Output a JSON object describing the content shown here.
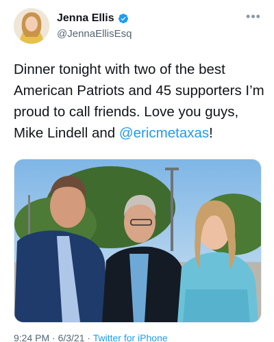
{
  "author": {
    "display_name": "Jenna Ellis",
    "handle": "@JennaEllisEsq",
    "verified": true
  },
  "more_icon": "more-horizontal-icon",
  "tweet": {
    "text_before_mention": "Dinner tonight with two of the best American Patriots and 45 supporters I’m proud to call friends. Love you guys, Mike Lindell and ",
    "mention": "@ericmetaxas",
    "text_after_mention": "!"
  },
  "meta": {
    "time_and_date": "9:24 PM · 6/3/21 · ",
    "source_app": "Twitter for iPhone"
  },
  "colors": {
    "link": "#1d9bf0",
    "verified": "#1d9bf0",
    "secondary_text": "#536471"
  }
}
